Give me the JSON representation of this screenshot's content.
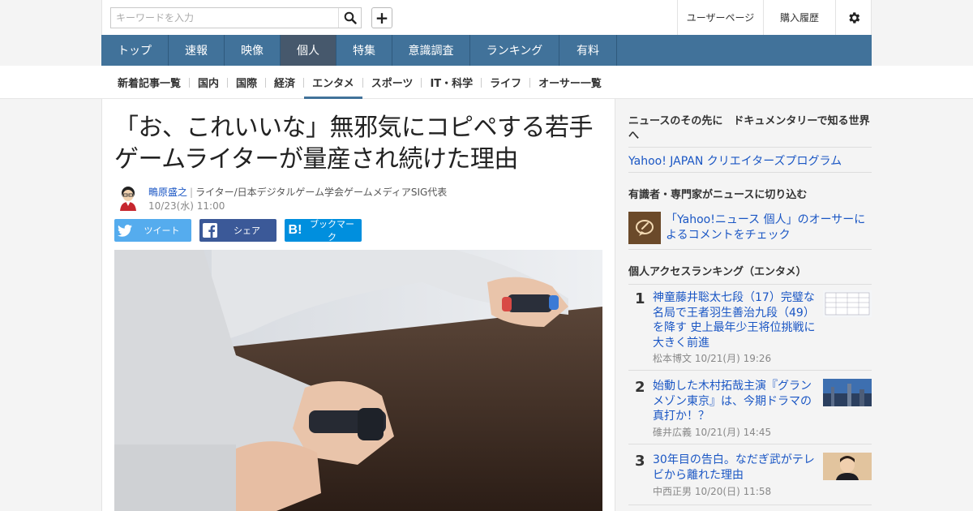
{
  "search": {
    "placeholder": "キーワードを入力"
  },
  "util_links": [
    "ユーザーページ",
    "購入履歴"
  ],
  "global_nav": [
    {
      "label": "トップ"
    },
    {
      "label": "速報"
    },
    {
      "label": "映像"
    },
    {
      "label": "個人",
      "active": true
    },
    {
      "label": "特集"
    },
    {
      "label": "意識調査"
    },
    {
      "label": "ランキング"
    },
    {
      "label": "有料"
    }
  ],
  "sub_nav": [
    {
      "label": "新着記事一覧"
    },
    {
      "label": "国内"
    },
    {
      "label": "国際"
    },
    {
      "label": "経済"
    },
    {
      "label": "エンタメ",
      "active": true
    },
    {
      "label": "スポーツ"
    },
    {
      "label": "IT・科学"
    },
    {
      "label": "ライフ"
    },
    {
      "label": "オーサー一覧"
    }
  ],
  "article": {
    "title": "「お、これいいな」無邪気にコピペする若手ゲームライターが量産され続けた理由",
    "author_name": "鴫原盛之",
    "author_role": "ライター/日本デジタルゲーム学会ゲームメディアSIG代表",
    "date": "10/23(水) 11:00",
    "share": {
      "twitter": "ツイート",
      "facebook": "シェア",
      "hatena": "ブックマーク"
    }
  },
  "sidebar": {
    "promo_heading": "ニュースのその先に　ドキュメンタリーで知る世界へ",
    "promo_link": "Yahoo! JAPAN クリエイターズプログラム",
    "expert_heading": "有識者・専門家がニュースに切り込む",
    "expert_link": "「Yahoo!ニュース 個人」のオーサーによるコメントをチェック",
    "ranking_heading": "個人アクセスランキング（エンタメ）",
    "ranking": [
      {
        "rank": "1",
        "title": "神童藤井聡太七段（17）完璧な名局で王者羽生善治九段（49）を降す 史上最年少王将位挑戦に大きく前進",
        "author": "松本博文",
        "date": "10/21(月) 19:26"
      },
      {
        "rank": "2",
        "title": "始動した木村拓哉主演『グランメゾン東京』は、今期ドラマの真打か！？",
        "author": "碓井広義",
        "date": "10/21(月) 14:45"
      },
      {
        "rank": "3",
        "title": "30年目の告白。なだぎ武がテレビから離れた理由",
        "author": "中西正男",
        "date": "10/20(日) 11:58"
      }
    ]
  }
}
